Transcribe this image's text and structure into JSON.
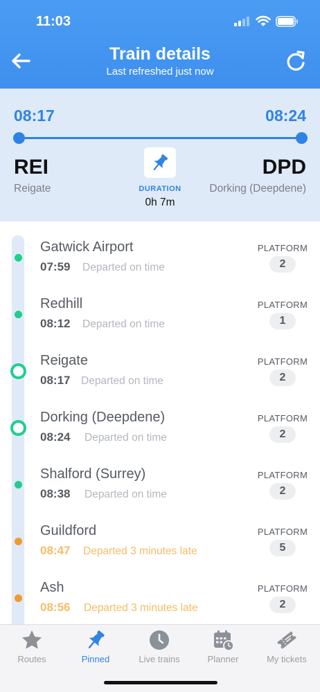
{
  "status_bar": {
    "time": "11:03"
  },
  "header": {
    "title": "Train details",
    "subtitle": "Last refreshed just now"
  },
  "journey": {
    "origin": {
      "time": "08:17",
      "code": "REI",
      "name": "Reigate"
    },
    "destination": {
      "time": "08:24",
      "code": "DPD",
      "name": "Dorking (Deepdene)"
    },
    "duration_label": "DURATION",
    "duration_value": "0h 7m"
  },
  "stops": [
    {
      "name": "Gatwick Airport",
      "time": "07:59",
      "status": "Departed on time",
      "platform_label": "PLATFORM",
      "platform": "2",
      "marker": "small",
      "color": "#1fcf8e"
    },
    {
      "name": "Redhill",
      "time": "08:12",
      "status": "Departed on time",
      "platform_label": "PLATFORM",
      "platform": "1",
      "marker": "small",
      "color": "#1fcf8e"
    },
    {
      "name": "Reigate",
      "time": "08:17",
      "status": "Departed on time",
      "platform_label": "PLATFORM",
      "platform": "2",
      "marker": "ring",
      "color": "#1fcf8e"
    },
    {
      "name": "Dorking (Deepdene)",
      "time": "08:24",
      "status": "Departed on time",
      "platform_label": "PLATFORM",
      "platform": "2",
      "marker": "ring",
      "color": "#1fcf8e"
    },
    {
      "name": "Shalford (Surrey)",
      "time": "08:38",
      "status": "Departed on time",
      "platform_label": "PLATFORM",
      "platform": "2",
      "marker": "small",
      "color": "#1fcf8e"
    },
    {
      "name": "Guildford",
      "time": "08:47",
      "status": "Departed 3 minutes late",
      "platform_label": "PLATFORM",
      "platform": "5",
      "marker": "small",
      "color": "#f39a2c"
    },
    {
      "name": "Ash",
      "time": "08:56",
      "status": "Departed 3 minutes late",
      "platform_label": "PLATFORM",
      "platform": "2",
      "marker": "small",
      "color": "#f39a2c"
    }
  ],
  "tabs": [
    {
      "label": "Routes",
      "icon": "star-icon",
      "active": false
    },
    {
      "label": "Pinned",
      "icon": "pin-icon",
      "active": true
    },
    {
      "label": "Live trains",
      "icon": "clock-icon",
      "active": false
    },
    {
      "label": "Planner",
      "icon": "calendar-icon",
      "active": false
    },
    {
      "label": "My tickets",
      "icon": "ticket-icon",
      "active": false
    }
  ],
  "colors": {
    "accent": "#2f83e4",
    "header": "#4a9cf3",
    "on_time": "#1fcf8e",
    "late": "#f39a2c"
  }
}
